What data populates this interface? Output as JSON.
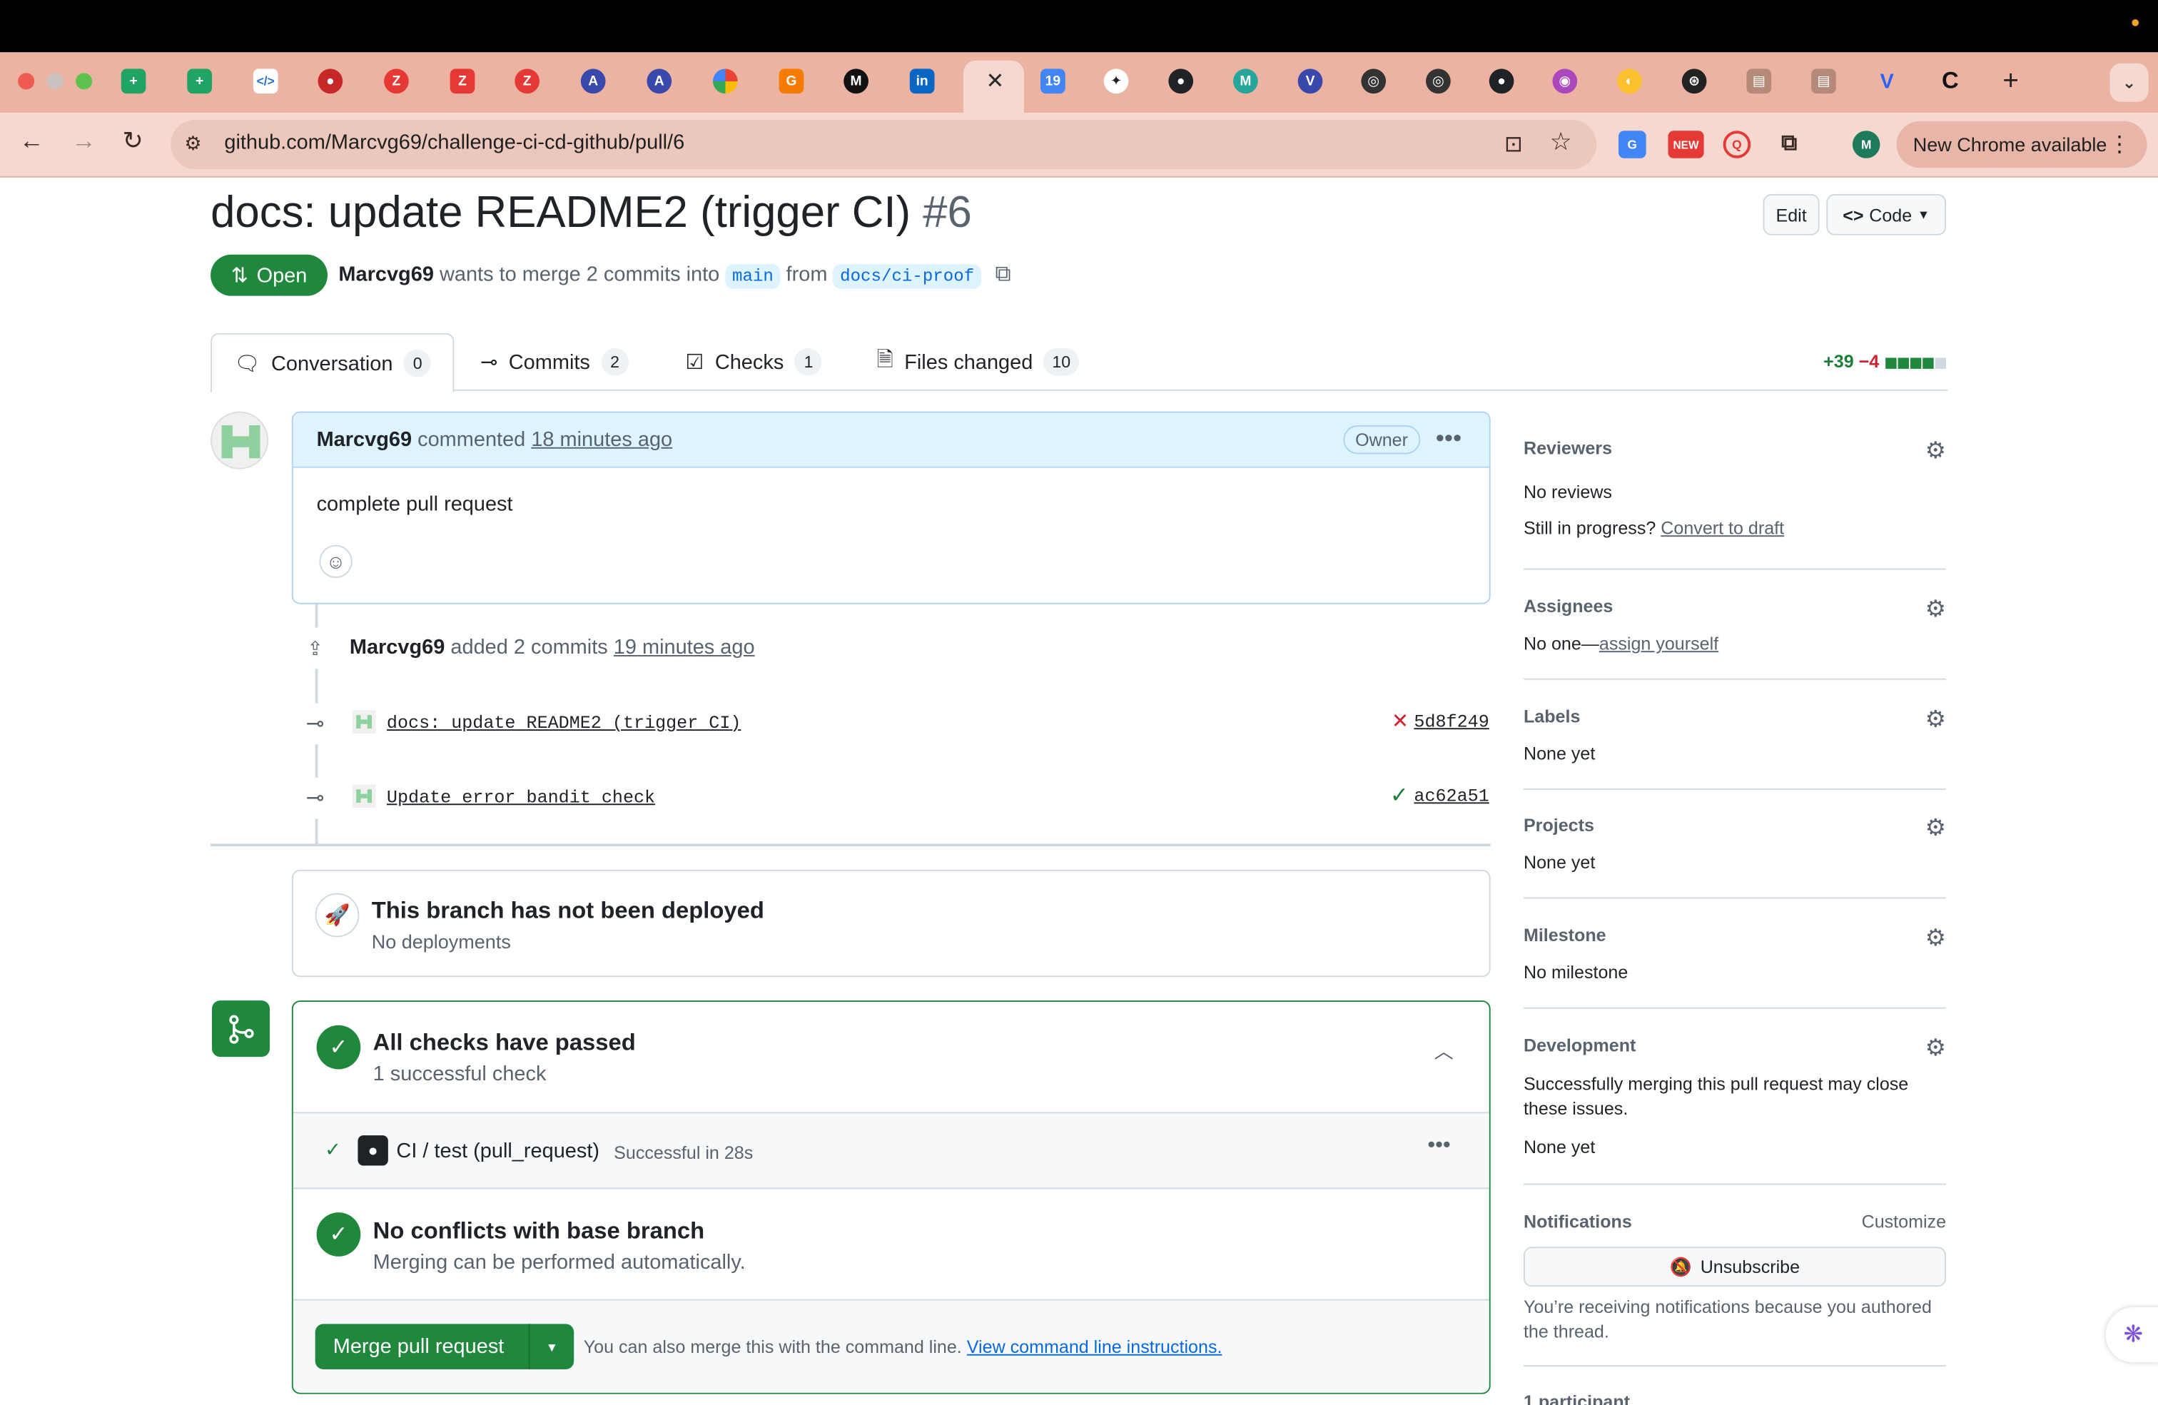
{
  "browser": {
    "url": "github.com/Marcvg69/challenge-ci-cd-github/pull/6",
    "update_label": "New Chrome available",
    "profile_initial": "M",
    "new_badge": "NEW"
  },
  "pr": {
    "title": "docs: update README2 (trigger CI)",
    "number": "#6",
    "edit_label": "Edit",
    "code_label": "Code",
    "state": "Open",
    "author": "Marcvg69",
    "meta_text": "wants to merge 2 commits into",
    "base_branch": "main",
    "from_text": "from",
    "head_branch": "docs/ci-proof"
  },
  "tabs": [
    {
      "label": "Conversation",
      "count": "0"
    },
    {
      "label": "Commits",
      "count": "2"
    },
    {
      "label": "Checks",
      "count": "1"
    },
    {
      "label": "Files changed",
      "count": "10"
    }
  ],
  "diffstat": {
    "additions": "+39",
    "deletions": "−4"
  },
  "comment": {
    "author": "Marcvg69",
    "verb": "commented",
    "time": "18 minutes ago",
    "role": "Owner",
    "body": "complete pull request"
  },
  "commits_event": {
    "author": "Marcvg69",
    "text": "added 2 commits",
    "time": "19 minutes ago"
  },
  "commits": [
    {
      "message": "docs: update README2 (trigger CI)",
      "sha": "5d8f249",
      "status": "failure"
    },
    {
      "message": "Update error bandit check",
      "sha": "ac62a51",
      "status": "success"
    }
  ],
  "deploy": {
    "title": "This branch has not been deployed",
    "subtitle": "No deployments"
  },
  "checks": {
    "title": "All checks have passed",
    "subtitle": "1 successful check",
    "job_name": "CI / test (pull_request)",
    "job_status": "Successful in 28s"
  },
  "conflicts": {
    "title": "No conflicts with base branch",
    "subtitle": "Merging can be performed automatically."
  },
  "merge": {
    "button": "Merge pull request",
    "hint": "You can also merge this with the command line.",
    "link": "View command line instructions."
  },
  "sidebar": {
    "reviewers": {
      "title": "Reviewers",
      "value": "No reviews",
      "draft_prefix": "Still in progress?",
      "draft_link": "Convert to draft"
    },
    "assignees": {
      "title": "Assignees",
      "value": "No one—",
      "link": "assign yourself"
    },
    "labels": {
      "title": "Labels",
      "value": "None yet"
    },
    "projects": {
      "title": "Projects",
      "value": "None yet"
    },
    "milestone": {
      "title": "Milestone",
      "value": "No milestone"
    },
    "development": {
      "title": "Development",
      "desc": "Successfully merging this pull request may close these issues.",
      "value": "None yet"
    },
    "notifications": {
      "title": "Notifications",
      "customize": "Customize",
      "button": "Unsubscribe",
      "desc": "You’re receiving notifications because you authored the thread."
    },
    "participants": {
      "title": "1 participant"
    }
  },
  "colors": {
    "primary": "#1f883d",
    "link": "#0969da",
    "danger": "#cf222e",
    "chrome_tab": "#ecb3a3"
  }
}
